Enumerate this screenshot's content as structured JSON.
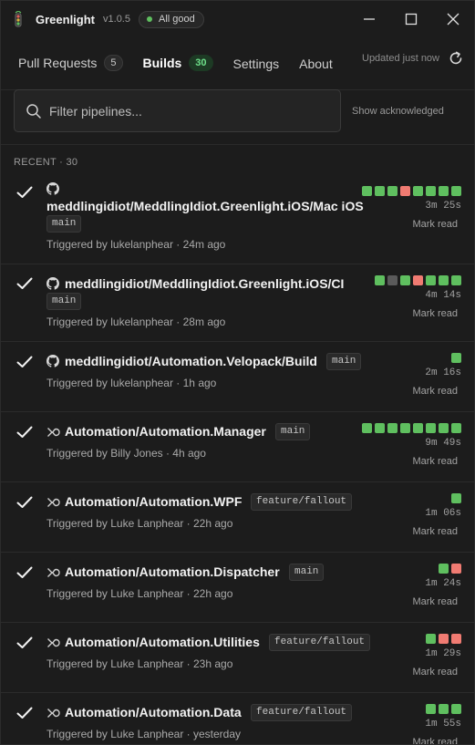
{
  "app": {
    "title": "Greenlight",
    "version": "v1.0.5",
    "status": "All good"
  },
  "tabs": [
    {
      "label": "Pull Requests",
      "count": "5"
    },
    {
      "label": "Builds",
      "count": "30"
    },
    {
      "label": "Settings"
    },
    {
      "label": "About"
    }
  ],
  "header": {
    "updated": "Updated just now"
  },
  "filter": {
    "placeholder": "Filter pipelines...",
    "show_acknowledged": "Show acknowledged"
  },
  "section_label": "RECENT · 30",
  "colors": {
    "green": "#5fbf5f",
    "red": "#f07b72",
    "grey": "#5a5a5a",
    "accent_green": "#6ee08a"
  },
  "builds": [
    {
      "title": "meddlingidiot/MeddlingIdiot.Greenlight.iOS/Mac iOS",
      "branch": "main",
      "trigger": "Triggered by lukelanphear · 24m ago",
      "duration": "3m 25s",
      "mark_read": "Mark read",
      "source": "github-icon",
      "history": [
        "green",
        "green",
        "green",
        "red",
        "green",
        "green",
        "green",
        "green"
      ]
    },
    {
      "title": "meddlingidiot/MeddlingIdiot.Greenlight.iOS/CI",
      "branch": "main",
      "trigger": "Triggered by lukelanphear · 28m ago",
      "duration": "4m 14s",
      "mark_read": "Mark read",
      "source": "github-icon",
      "history": [
        "green",
        "grey",
        "green",
        "red",
        "green",
        "green",
        "green"
      ]
    },
    {
      "title": "meddlingidiot/Automation.Velopack/Build",
      "branch": "main",
      "trigger": "Triggered by lukelanphear · 1h ago",
      "duration": "2m 16s",
      "mark_read": "Mark read",
      "source": "github-icon",
      "history": [
        "green"
      ]
    },
    {
      "title": "Automation/Automation.Manager",
      "branch": "main",
      "trigger": "Triggered by Billy Jones · 4h ago",
      "duration": "9m 49s",
      "mark_read": "Mark read",
      "source": "azure-pipelines-icon",
      "history": [
        "green",
        "green",
        "green",
        "green",
        "green",
        "green",
        "green",
        "green"
      ]
    },
    {
      "title": "Automation/Automation.WPF",
      "branch": "feature/fallout",
      "trigger": "Triggered by Luke Lanphear · 22h ago",
      "duration": "1m 06s",
      "mark_read": "Mark read",
      "source": "azure-pipelines-icon",
      "history": [
        "green"
      ]
    },
    {
      "title": "Automation/Automation.Dispatcher",
      "branch": "main",
      "trigger": "Triggered by Luke Lanphear · 22h ago",
      "duration": "1m 24s",
      "mark_read": "Mark read",
      "source": "azure-pipelines-icon",
      "history": [
        "green",
        "red"
      ]
    },
    {
      "title": "Automation/Automation.Utilities",
      "branch": "feature/fallout",
      "trigger": "Triggered by Luke Lanphear · 23h ago",
      "duration": "1m 29s",
      "mark_read": "Mark read",
      "source": "azure-pipelines-icon",
      "history": [
        "green",
        "red",
        "red"
      ]
    },
    {
      "title": "Automation/Automation.Data",
      "branch": "feature/fallout",
      "trigger": "Triggered by Luke Lanphear · yesterday",
      "duration": "1m 55s",
      "mark_read": "Mark read",
      "source": "azure-pipelines-icon",
      "history": [
        "green",
        "green",
        "green"
      ]
    }
  ]
}
